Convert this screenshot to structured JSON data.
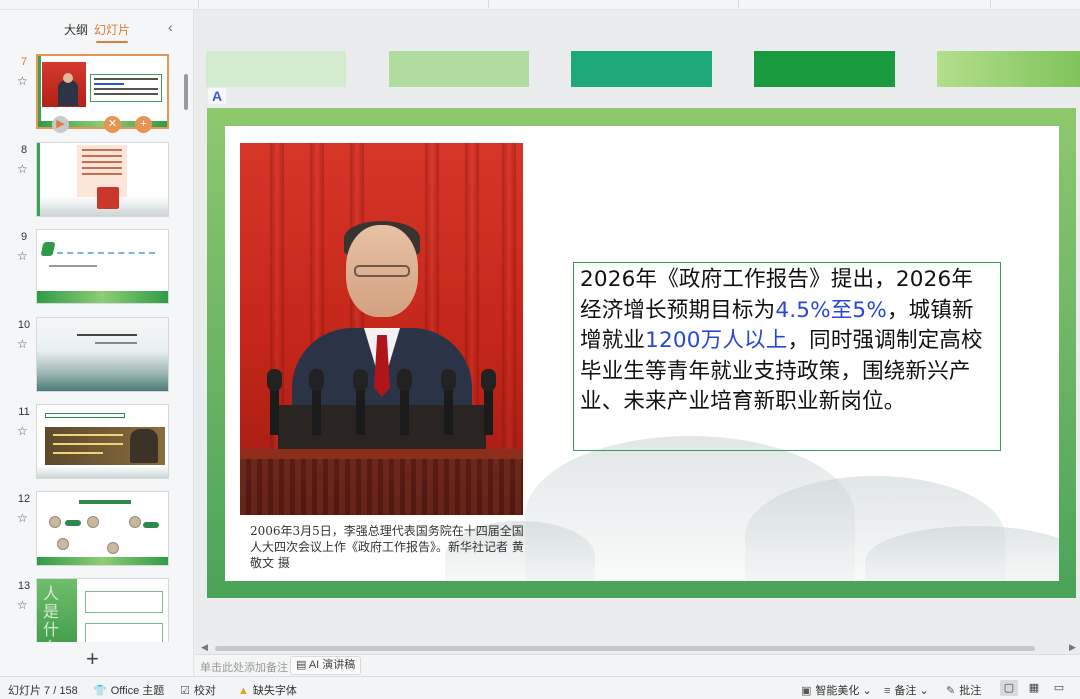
{
  "panel": {
    "tabs": [
      "大纲",
      "幻灯片"
    ],
    "active_tab": "幻灯片",
    "collapse_icon": "chevron-left-icon",
    "add_slide": "+"
  },
  "thumbnails": [
    {
      "num": "7",
      "selected": true
    },
    {
      "num": "8",
      "selected": false
    },
    {
      "num": "9",
      "selected": false
    },
    {
      "num": "10",
      "selected": false
    },
    {
      "num": "11",
      "selected": false
    },
    {
      "num": "12",
      "selected": false
    },
    {
      "num": "13",
      "selected": false
    }
  ],
  "theme_colors": [
    "#d3ecd0",
    "#b0dca0",
    "#1fa97a",
    "#1a9a3f",
    "#a8d77e"
  ],
  "slide": {
    "main_text_parts": [
      {
        "text": "2026年《政府工作报告》提出，2026年经济增长预期目标为",
        "hl": false
      },
      {
        "text": "4.5%至5%",
        "hl": true
      },
      {
        "text": "，城镇新增就业",
        "hl": false
      },
      {
        "text": "1200万人以上",
        "hl": true
      },
      {
        "text": "，同时强调制定高校毕业生等青年就业支持政策，围绕新兴产业、未来产业培育新职业新岗位。",
        "hl": false
      }
    ],
    "caption": "2006年3月5日，李强总理代表国务院在十四届全国人大四次会议上作《政府工作报告》。新华社记者 黄敬文 摄",
    "highlight_color": "#2848d4"
  },
  "notes": {
    "placeholder": "单击此处添加备注",
    "ai_button": "AI 演讲稿"
  },
  "status": {
    "slide_counter": "幻灯片 7 / 158",
    "theme": "Office 主题",
    "proofread": "校对",
    "missing_fonts": "缺失字体",
    "beautify": "智能美化",
    "notes": "备注",
    "comments": "批注"
  }
}
